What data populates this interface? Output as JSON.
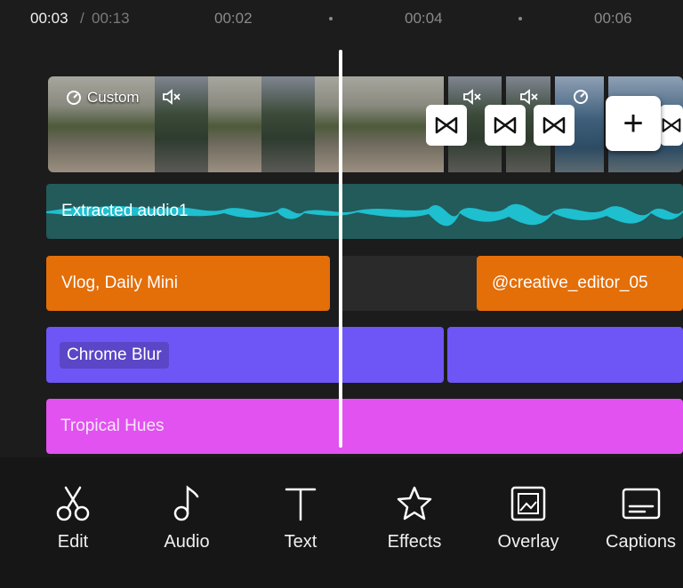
{
  "ruler": {
    "current_time": "00:03",
    "separator": "/",
    "total_time": "00:13",
    "ticks": [
      "00:02",
      "00:04",
      "00:06"
    ]
  },
  "video_track": {
    "clip_label": "Custom",
    "icons": [
      "speed-icon",
      "mute-icon"
    ]
  },
  "transitions": {
    "icon": "bowtie-transition-icon"
  },
  "add_clip": {
    "label": "+"
  },
  "audio_track": {
    "label": "Extracted audio1",
    "waveform_color": "#1ebfcf"
  },
  "text_tracks": [
    {
      "label": "Vlog, Daily Mini"
    },
    {
      "label": "@creative_editor_05"
    }
  ],
  "effect_track": {
    "label": "Chrome Blur"
  },
  "filter_track": {
    "label": "Tropical Hues"
  },
  "toolbar": {
    "items": [
      {
        "label": "Edit",
        "icon": "scissors-icon"
      },
      {
        "label": "Audio",
        "icon": "music-note-icon"
      },
      {
        "label": "Text",
        "icon": "text-icon"
      },
      {
        "label": "Effects",
        "icon": "star-icon"
      },
      {
        "label": "Overlay",
        "icon": "overlay-icon"
      },
      {
        "label": "Captions",
        "icon": "captions-icon"
      }
    ]
  },
  "colors": {
    "text_track": "#e46e08",
    "effect_track": "#6e55f5",
    "filter_track": "#e152f0",
    "audio_track": "#235a5a"
  }
}
